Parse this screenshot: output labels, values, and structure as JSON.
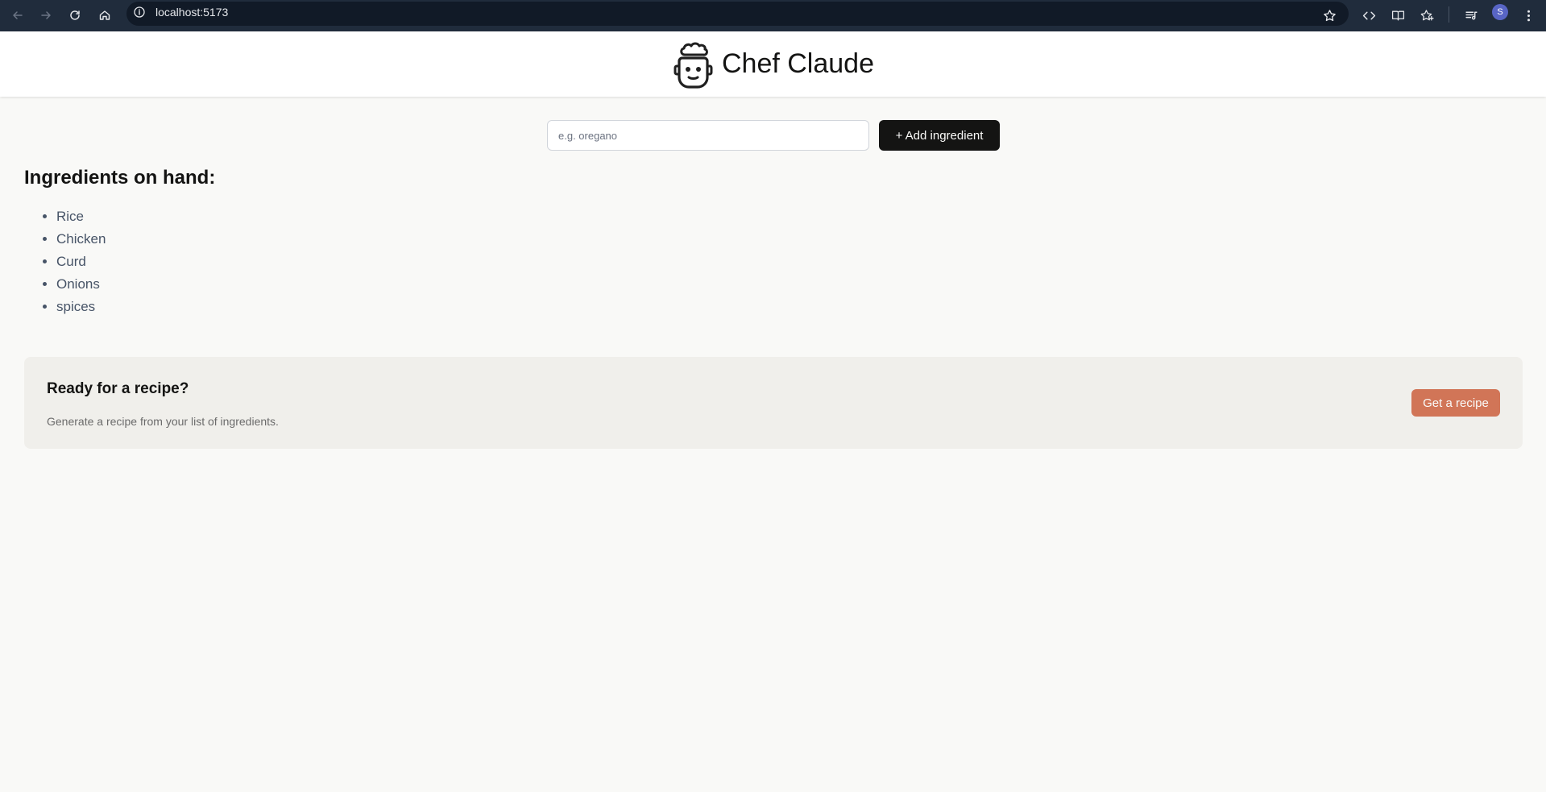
{
  "browser": {
    "url": "localhost:5173",
    "profile_initial": "S",
    "icons": [
      "back-icon",
      "forward-icon",
      "reload-icon",
      "home-icon",
      "site-info-icon",
      "bookmark-star-icon",
      "code-icon",
      "reader-mode-icon",
      "favorites-icon",
      "media-queue-icon",
      "more-menu-icon"
    ]
  },
  "header": {
    "title": "Chef Claude",
    "logo_icon": "chef-robot-icon"
  },
  "form": {
    "placeholder": "e.g. oregano",
    "value": "",
    "add_button_label": "+ Add ingredient"
  },
  "ingredients": {
    "heading": "Ingredients on hand:",
    "items": [
      "Rice",
      "Chicken",
      "Curd",
      "Onions",
      "spices"
    ]
  },
  "recipe_cta": {
    "title": "Ready for a recipe?",
    "subtitle": "Generate a recipe from your list of ingredients.",
    "button_label": "Get a recipe"
  },
  "colors": {
    "page_background": "#f9f9f7",
    "header_background": "#ffffff",
    "primary_button": "#141413",
    "accent_button": "#d17557",
    "card_background": "#f0efeb",
    "chrome_background": "#202c3c"
  }
}
